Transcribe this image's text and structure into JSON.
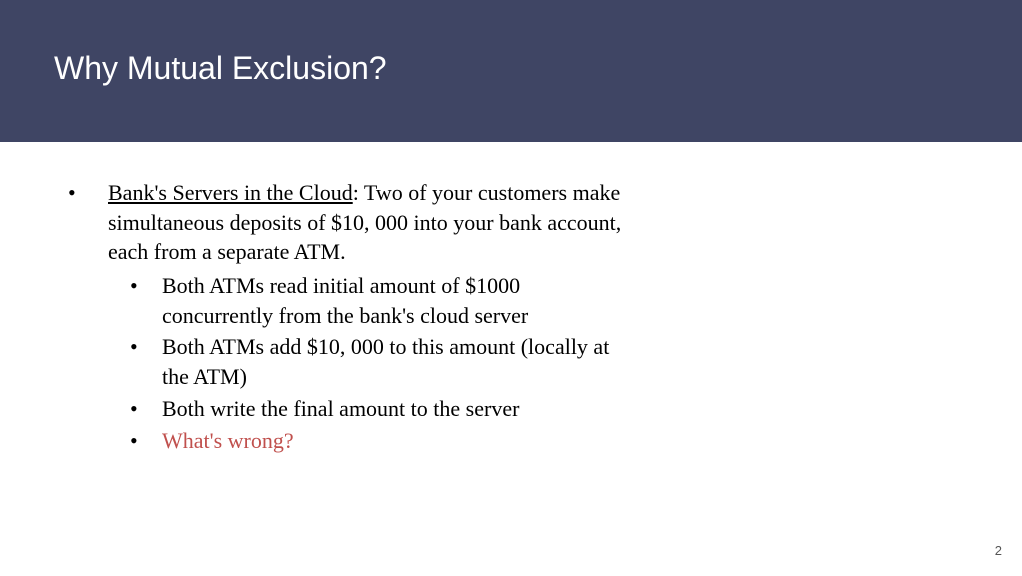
{
  "title": "Why Mutual Exclusion?",
  "intro": {
    "lead": "Bank's Servers in the Cloud",
    "rest": ": Two of your customers make simultaneous deposits of $10, 000 into your bank account, each from a separate ATM."
  },
  "sub": [
    {
      "text": "Both ATMs read initial amount of $1000 concurrently from the bank's cloud server",
      "highlight": false
    },
    {
      "text": "Both ATMs add $10, 000 to this amount (locally at the ATM)",
      "highlight": false
    },
    {
      "text": "Both write the final amount to the server",
      "highlight": false
    },
    {
      "text": "What's wrong?",
      "highlight": true
    }
  ],
  "page": "2"
}
